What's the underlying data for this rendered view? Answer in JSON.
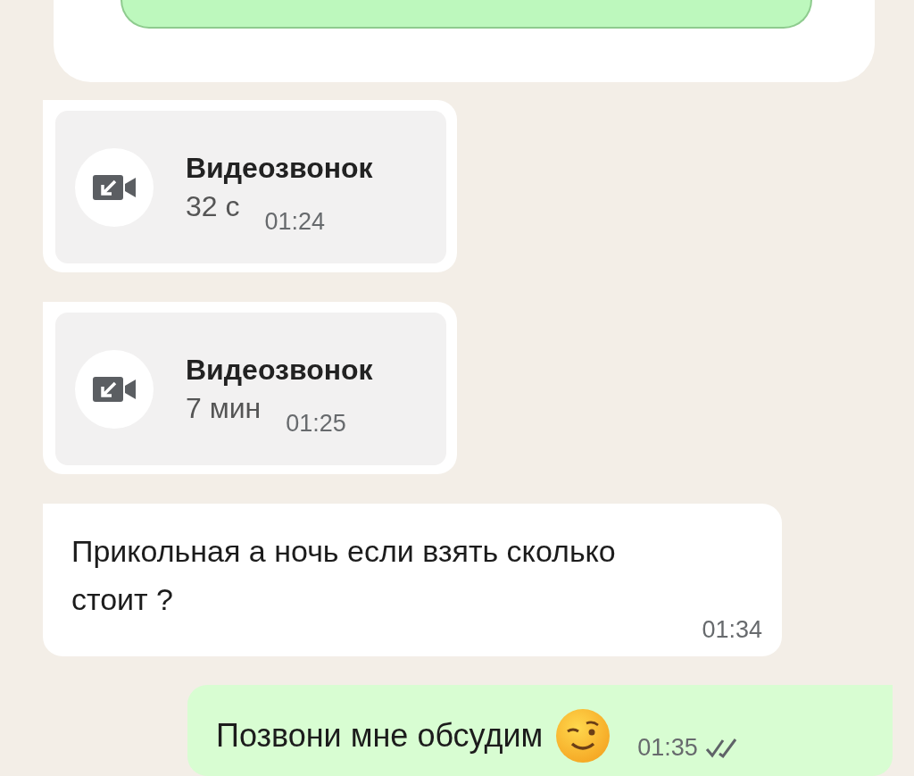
{
  "messages": [
    {
      "kind": "call",
      "outgoing": false,
      "title": "Видеозвонок",
      "duration": "32 с",
      "time": "01:24"
    },
    {
      "kind": "call",
      "outgoing": false,
      "title": "Видеозвонок",
      "duration": "7 мин",
      "time": "01:25"
    },
    {
      "kind": "text",
      "outgoing": false,
      "text": "Прикольная а ночь если взять сколько стоит ?",
      "time": "01:34"
    },
    {
      "kind": "text",
      "outgoing": true,
      "text": "Позвони мне обсудим",
      "has_emoji": true,
      "time": "01:35",
      "read": false
    }
  ]
}
